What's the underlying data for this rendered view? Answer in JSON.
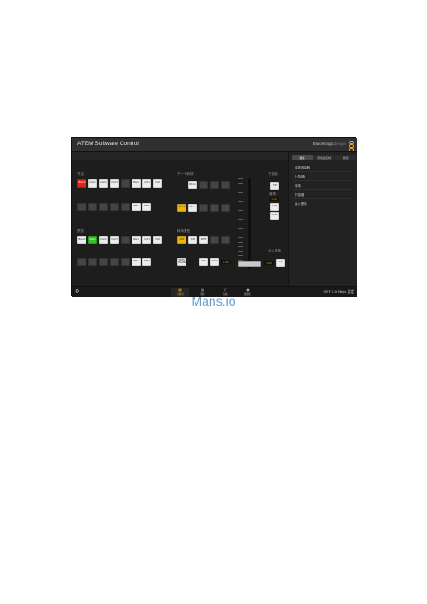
{
  "app": {
    "title": "ATEM Software Control",
    "brand": "Blackmagicdesign",
    "brand_bold": "Blackmagic",
    "brand_light": "design"
  },
  "sections": {
    "program": "节目",
    "preview": "预览",
    "next_transition": "下一个转场",
    "transition_style": "转场类型",
    "downstream_key": "下游键",
    "fade_to_black": "淡入黑场",
    "rate": "速率"
  },
  "buttons": {
    "black": "Black",
    "cam1": "Cam1",
    "cam2": "Cam2",
    "cam3": "Cam3",
    "bars": "Bars",
    "col1": "Col1",
    "col2": "Col2",
    "mp1": "MP1",
    "mp2": "MP2",
    "bkgd": "BKGD",
    "key1": "KEY 1",
    "mix": "MIX",
    "dip": "DIP",
    "wipe": "WIPE",
    "auto": "AUTO",
    "cut": "CUT",
    "prev_trans": "PREV TRANS",
    "tie": "TIE",
    "dsk_cut": "CUT",
    "dsk_auto": "AUTO",
    "ftb": "FTB"
  },
  "readouts": {
    "trans_rate": "1:00",
    "dsk_rate": "1:00",
    "ftb_rate": "1:00"
  },
  "right_panel": {
    "tabs": [
      "媒体",
      "调色盘控制",
      "音频"
    ],
    "active_tab": 0,
    "items": [
      "转场选择器",
      "上游键1",
      "转场",
      "下游键",
      "淡入黑场"
    ]
  },
  "bottom_nav": [
    {
      "icon": "switcher-icon",
      "label": "切换台"
    },
    {
      "icon": "media-icon",
      "label": "媒体"
    },
    {
      "icon": "audio-icon",
      "label": "音频"
    },
    {
      "icon": "camera-icon",
      "label": "摄影机"
    }
  ],
  "status": {
    "text": "OFF  0.0 Mb/s  设定"
  },
  "watermark": "Mans.io",
  "colors": {
    "program_active": "#e2231a",
    "preview_active": "#35c227",
    "transition_active": "#f0b400",
    "accent": "#f39a1e",
    "watermark": "#5f9bd3"
  }
}
